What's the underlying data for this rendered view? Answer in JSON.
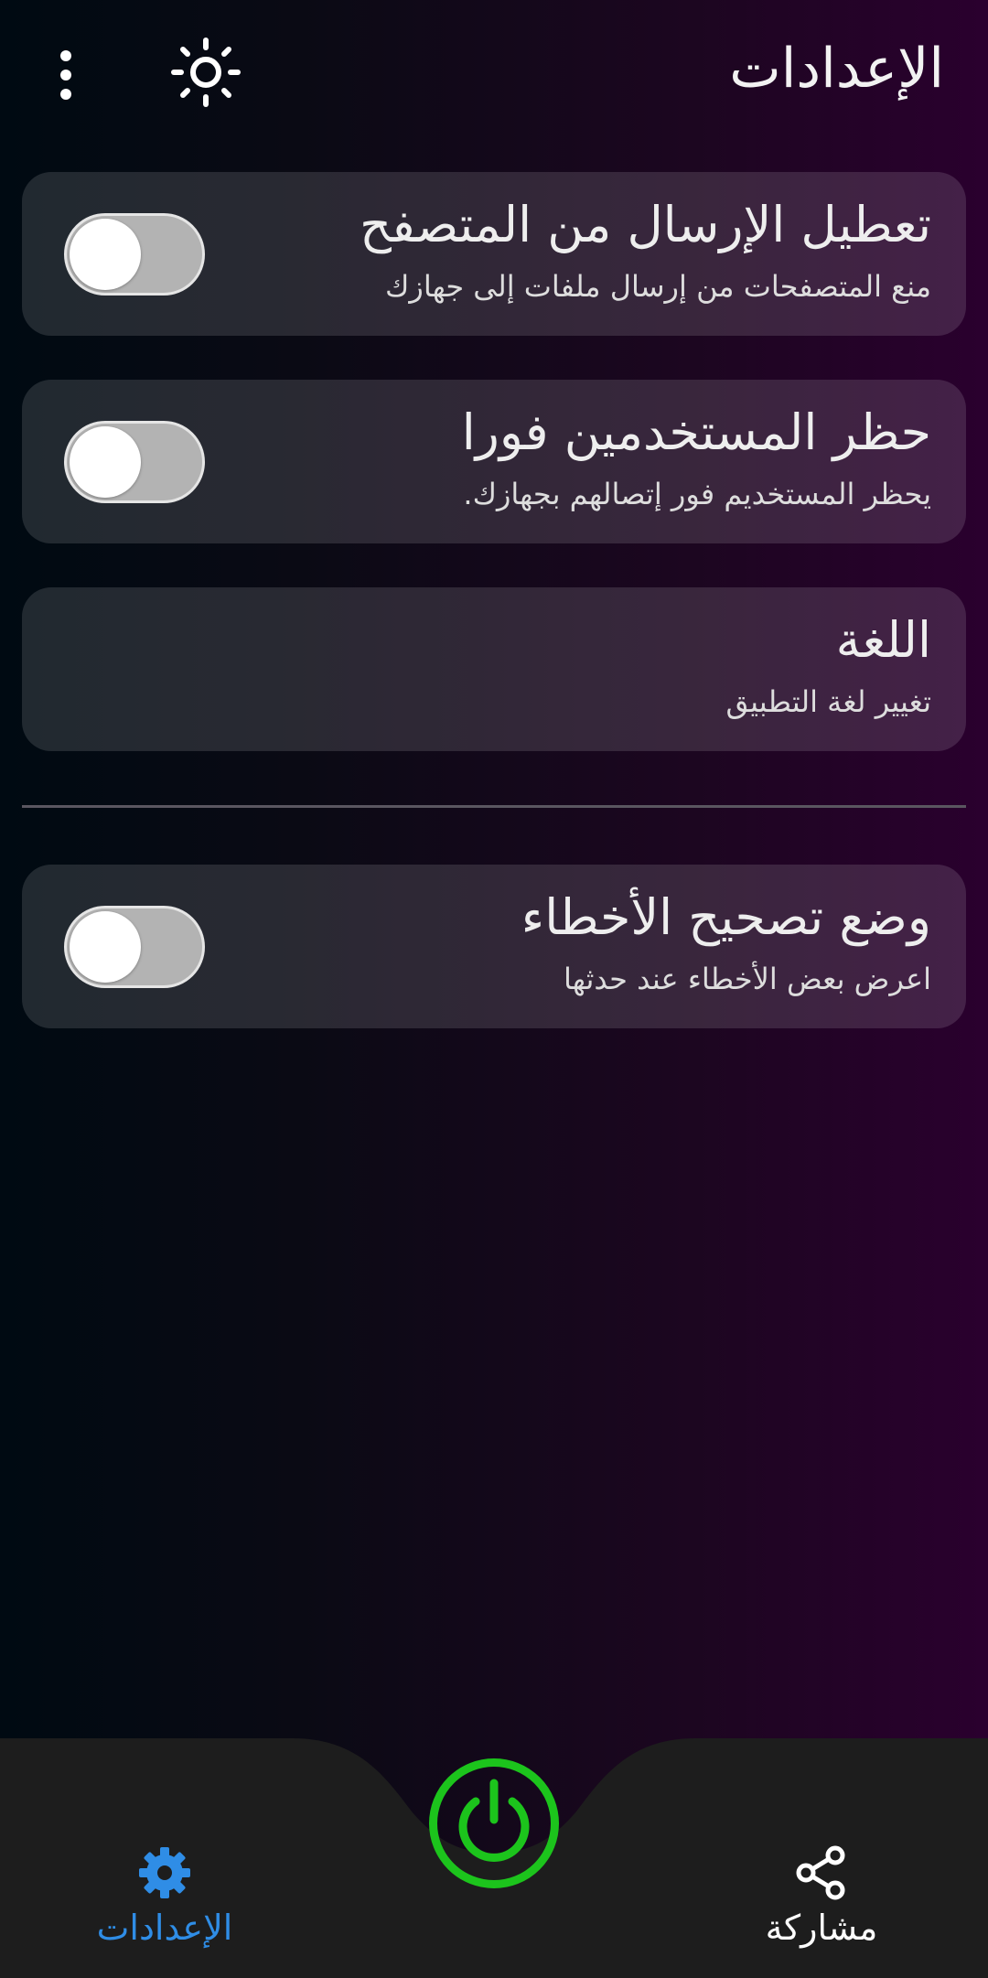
{
  "header": {
    "title": "الإعدادات",
    "menu_icon": "more-vert-icon",
    "theme_icon": "brightness-icon"
  },
  "settings": [
    {
      "title": "تعطيل الإرسال من المتصفح",
      "subtitle": "منع المتصفحات من إرسال ملفات إلى جهازك",
      "toggle": false
    },
    {
      "title": "حظر المستخدمين فورا",
      "subtitle": "يحظر المستخديم فور إتصالهم بجهازك.",
      "toggle": false
    },
    {
      "title": "اللغة",
      "subtitle": "تغيير لغة التطبيق"
    },
    {
      "title": "وضع تصحيح الأخطاء",
      "subtitle": "اعرض بعض الأخطاء عند حدثها",
      "toggle": false
    }
  ],
  "bottom_nav": {
    "settings_label": "الإعدادات",
    "share_label": "مشاركة",
    "power_icon": "power-icon",
    "active_color": "#2f8de6",
    "power_color": "#1cc41c"
  }
}
